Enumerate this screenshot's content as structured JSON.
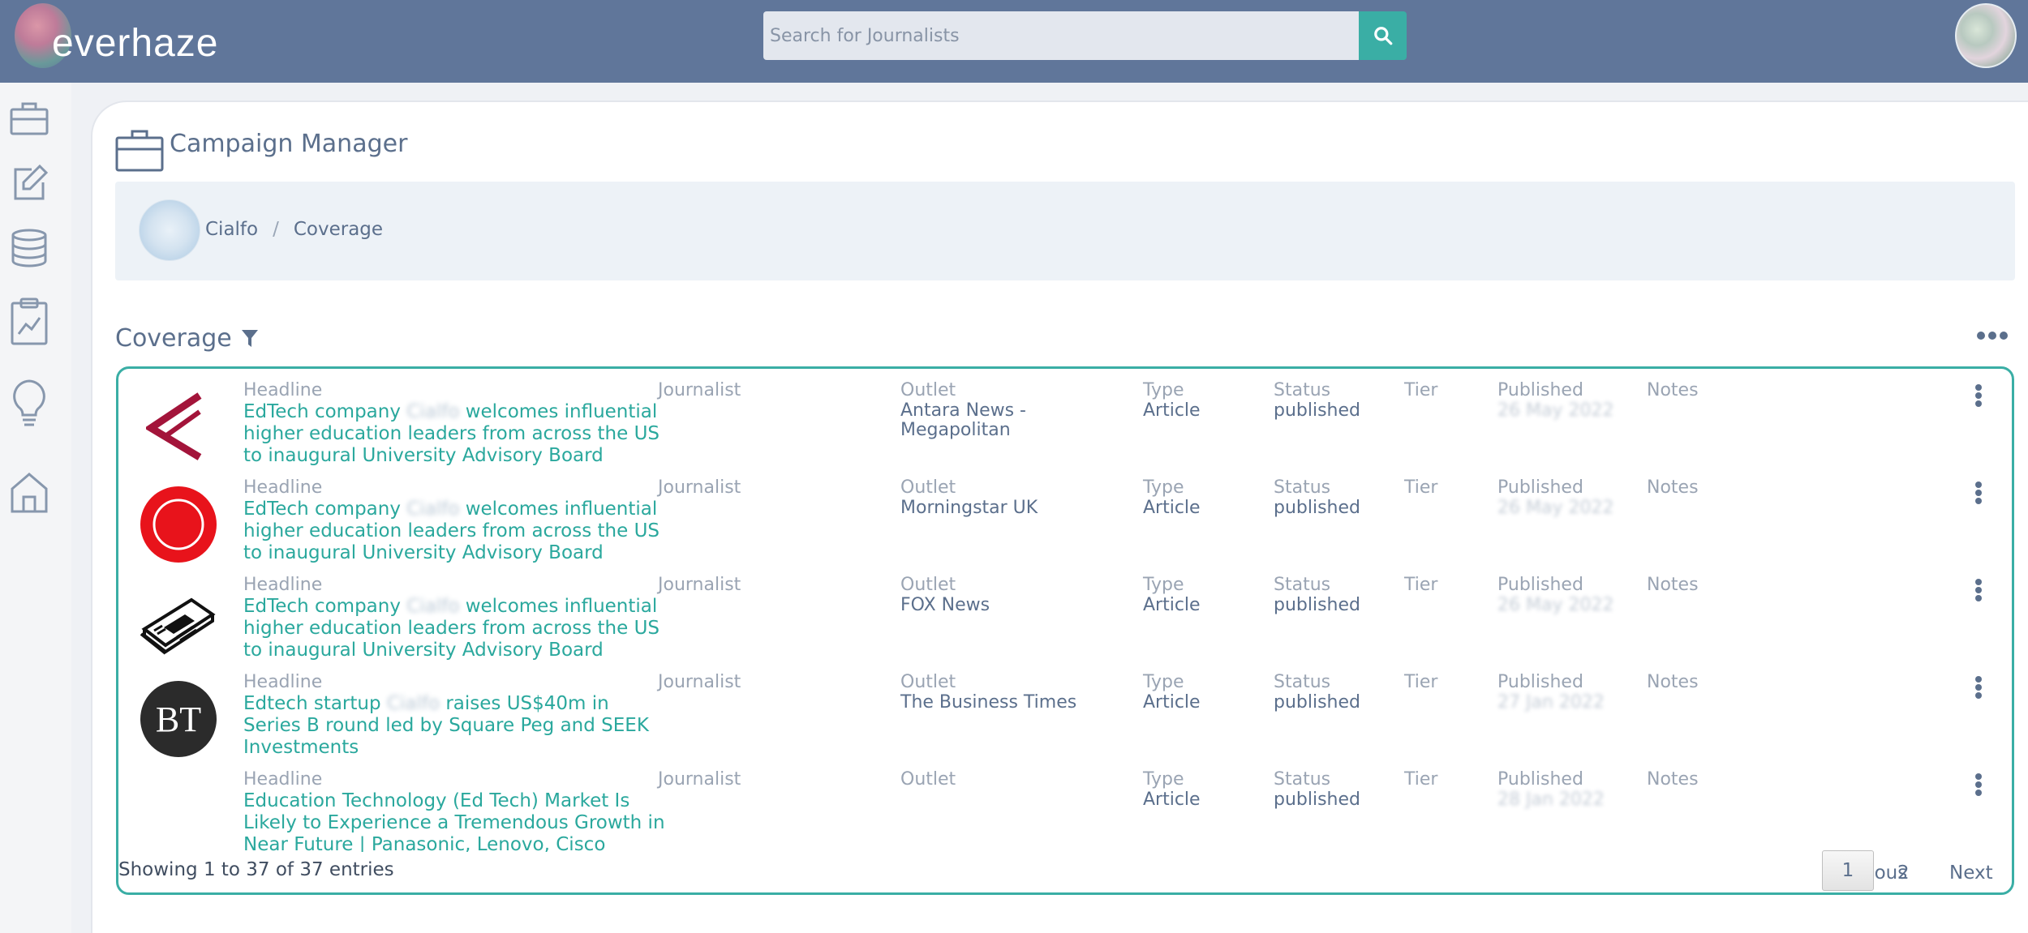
{
  "app": {
    "logo_text": "everhaze"
  },
  "search": {
    "placeholder": "Search for Journalists"
  },
  "sidebar": {
    "items": [
      "briefcase-icon",
      "edit-icon",
      "database-icon",
      "clipboard-chart-icon",
      "lightbulb-icon",
      "home-icon"
    ]
  },
  "page": {
    "title": "Campaign Manager"
  },
  "breadcrumb": {
    "client": "Cialfo",
    "separator": "/",
    "current": "Coverage"
  },
  "coverage": {
    "title": "Coverage"
  },
  "labels": {
    "headline": "Headline",
    "journalist": "Journalist",
    "outlet": "Outlet",
    "type": "Type",
    "status": "Status",
    "tier": "Tier",
    "published": "Published",
    "notes": "Notes"
  },
  "rows": [
    {
      "logo": "antara-logo",
      "headline_pre": "EdTech company ",
      "headline_blur": "Cialfo",
      "headline_post": " welcomes influential higher education leaders from across the US to inaugural University Advisory Board",
      "outlet": "Antara News - Megapolitan",
      "type": "Article",
      "status": "published",
      "published": "26 May 2022"
    },
    {
      "logo": "morningstar-logo",
      "headline_pre": "EdTech company ",
      "headline_blur": "Cialfo",
      "headline_post": " welcomes influential higher education leaders from across the US to inaugural University Advisory Board",
      "outlet": "Morningstar UK",
      "type": "Article",
      "status": "published",
      "published": "26 May 2022"
    },
    {
      "logo": "newspaper-logo",
      "headline_pre": "EdTech company ",
      "headline_blur": "Cialfo",
      "headline_post": " welcomes influential higher education leaders from across the US to inaugural University Advisory Board",
      "outlet": "FOX News",
      "type": "Article",
      "status": "published",
      "published": "26 May 2022"
    },
    {
      "logo": "bt-logo",
      "headline_pre": "Edtech startup ",
      "headline_blur": "Cialfo",
      "headline_post": " raises US$40m in Series B round led by Square Peg and SEEK Investments",
      "outlet": "The Business Times",
      "type": "Article",
      "status": "published",
      "published": "27 Jan 2022"
    },
    {
      "logo": "none",
      "headline_pre": "Education Technology (Ed Tech) Market Is Likely to Experience a Tremendous Growth in Near Future | Panasonic, Lenovo, Cisco",
      "headline_blur": "",
      "headline_post": "",
      "outlet": "",
      "type": "Article",
      "status": "published",
      "published": "28 Jan 2022"
    }
  ],
  "bt_logo_text": "BT",
  "footer": {
    "showing": "Showing 1 to 37 of 37 entries"
  },
  "pagination": {
    "previous": "Previous",
    "current": "1",
    "page2": "2",
    "next": "Next"
  },
  "colors": {
    "topbar": "#60769a",
    "accent": "#3aaea5",
    "headline": "#2aa89d"
  }
}
